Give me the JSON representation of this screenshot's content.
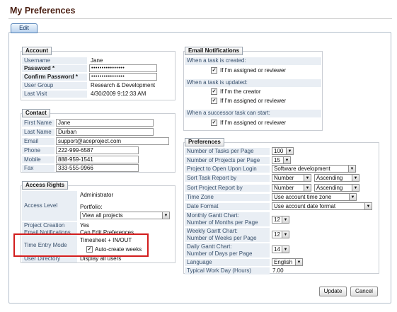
{
  "page": {
    "title": "My Preferences",
    "edit_tab": "Edit"
  },
  "account": {
    "legend": "Account",
    "username_label": "Username",
    "username": "Jane",
    "password_label": "Password *",
    "password": "••••••••••••••••",
    "confirm_label": "Confirm Password *",
    "confirm": "••••••••••••••••",
    "group_label": "User Group",
    "group": "Research & Development",
    "visit_label": "Last Visit",
    "visit": "4/30/2009 9:12:33 AM"
  },
  "contact": {
    "legend": "Contact",
    "first_label": "First Name",
    "first": "Jane",
    "last_label": "Last Name",
    "last": "Durban",
    "email_label": "Email",
    "email": "support@aceproject.com",
    "phone_label": "Phone",
    "phone": "222-999-6587",
    "mobile_label": "Mobile",
    "mobile": "888-959-1541",
    "fax_label": "Fax",
    "fax": "333-555-9966"
  },
  "access": {
    "legend": "Access Rights",
    "level_label": "Access Level",
    "level": "Administrator",
    "portfolio_label": "Portfolio:",
    "portfolio": "View all projects",
    "creation_label": "Project Creation",
    "creation": "Yes",
    "notif_label": "Email Notifications",
    "notif": "Can Edit Preferences",
    "time_label": "Time Entry Mode",
    "time": "Timesheet + IN/OUT",
    "auto_label": "Auto-create weeks",
    "dir_label": "User Directory",
    "dir": "Display all users"
  },
  "email": {
    "legend": "Email Notifications",
    "created_header": "When a task is created:",
    "created_opt": "If I'm assigned or reviewer",
    "updated_header": "When a task is updated:",
    "updated_opt1": "If I'm the creator",
    "updated_opt2": "If I'm assigned or reviewer",
    "successor_header": "When a successor task can start:",
    "successor_opt": "If I'm assigned or reviewer"
  },
  "prefs": {
    "legend": "Preferences",
    "tasks_label": "Number of Tasks per Page",
    "tasks": "100",
    "projects_label": "Number of Projects per Page",
    "projects": "15",
    "open_label": "Project to Open Upon Login",
    "open": "Software development",
    "task_sort_label": "Sort Task Report by",
    "task_sort": "Number",
    "task_order": "Ascending",
    "proj_sort_label": "Sort Project Report by",
    "proj_sort": "Number",
    "proj_order": "Ascending",
    "tz_label": "Time Zone",
    "tz": "Use account time zone",
    "date_label": "Date Format",
    "date": "Use account date format",
    "mg_label1": "Monthly Gantt Chart:",
    "mg_label2": "Number of Months per Page",
    "mg": "12",
    "wg_label1": "Weekly Gantt Chart:",
    "wg_label2": "Number of Weeks per Page",
    "wg": "12",
    "dg_label1": "Daily Gantt Chart:",
    "dg_label2": "Number of Days per Page",
    "dg": "14",
    "lang_label": "Language",
    "lang": "English",
    "workday_label": "Typical Work Day (Hours)",
    "workday": "7.00"
  },
  "buttons": {
    "update": "Update",
    "cancel": "Cancel"
  },
  "icons": {
    "dropdown": "chevron-down-icon",
    "check": "checkmark-icon"
  },
  "colors": {
    "title": "#4a1f12",
    "label_bg": "#e9eef4",
    "highlight": "#d21d1d"
  }
}
